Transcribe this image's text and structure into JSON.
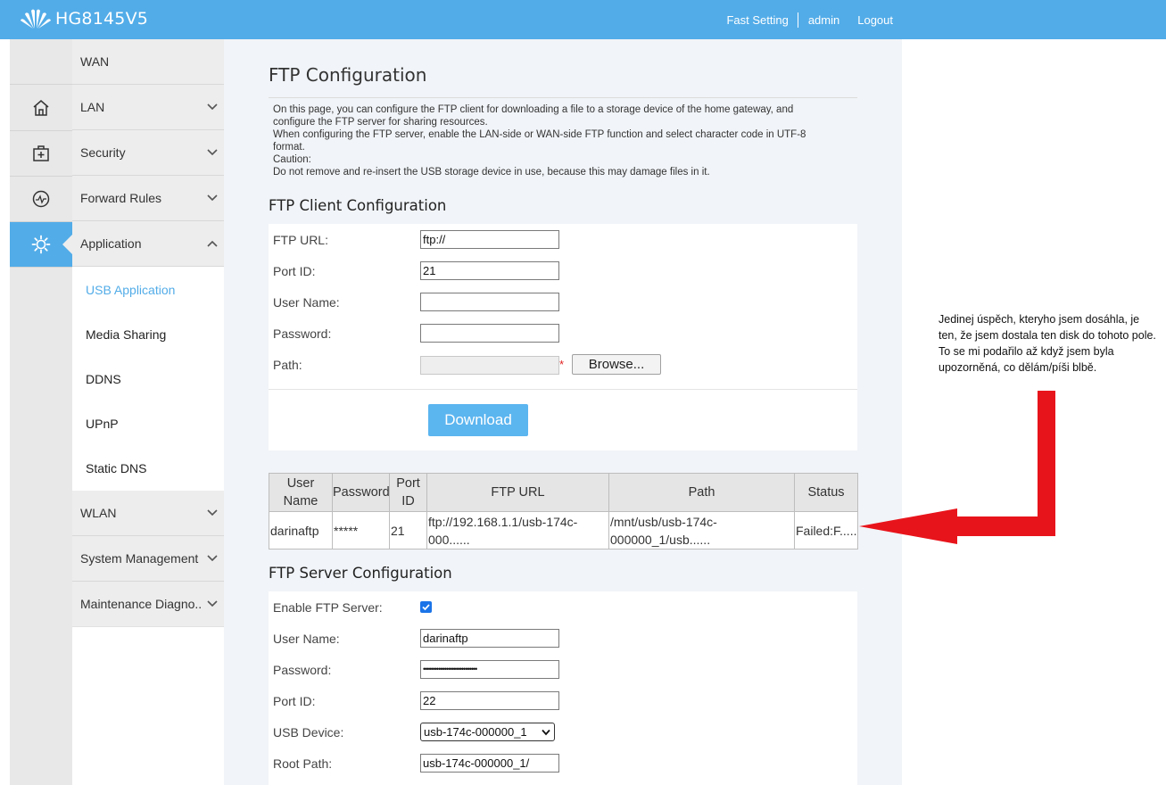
{
  "header": {
    "brand_icon": "huawei-logo",
    "model": "HG8145V5",
    "links": {
      "fast_setting": "Fast Setting",
      "admin": "admin",
      "logout": "Logout"
    },
    "bar_color": "#52ace8"
  },
  "icons": {
    "home": "home-icon",
    "plus": "add-box-icon",
    "monitor": "pulse-icon",
    "application": "gear-icon"
  },
  "menu": {
    "items": {
      "wan": "WAN",
      "lan": "LAN",
      "security": "Security",
      "forward": "Forward Rules",
      "application": "Application",
      "wlan": "WLAN",
      "system": "System Management",
      "maintenance": "Maintenance Diagno.."
    },
    "sub": {
      "usb": "USB Application",
      "media": "Media Sharing",
      "ddns": "DDNS",
      "upnp": "UPnP",
      "staticdns": "Static DNS"
    }
  },
  "page": {
    "title": "FTP Configuration",
    "description": [
      "On this page, you can configure the FTP client for downloading a file to a storage device of the home gateway, and",
      "configure the FTP server for sharing resources.",
      "When configuring the FTP server, enable the LAN-side or WAN-side FTP function and select character code in UTF-8",
      "format.",
      "Caution:",
      "Do not remove and re-insert the USB storage device in use, because this may damage files in it."
    ]
  },
  "client": {
    "title": "FTP Client Configuration",
    "labels": {
      "url": "FTP URL:",
      "port": "Port ID:",
      "user": "User Name:",
      "password": "Password:",
      "path": "Path:"
    },
    "values": {
      "url": "ftp://",
      "port": "21",
      "user": "",
      "password": "",
      "path": ""
    },
    "required_mark": "*",
    "browse": "Browse...",
    "download": "Download"
  },
  "table": {
    "headers": {
      "user": "User Name",
      "password": "Password",
      "port": "Port ID",
      "url": "FTP URL",
      "path": "Path",
      "status": "Status"
    },
    "row": {
      "user": "darinaftp",
      "password": "*****",
      "port": "21",
      "url": "ftp://192.168.1.1/usb-174c-000......",
      "path": "/mnt/usb/usb-174c-000000_1/usb......",
      "status": "Failed:F......"
    }
  },
  "server": {
    "title": "FTP Server Configuration",
    "labels": {
      "enable": "Enable FTP Server:",
      "user": "User Name:",
      "password": "Password:",
      "port": "Port ID:",
      "device": "USB Device:",
      "root": "Root Path:"
    },
    "values": {
      "enable": true,
      "user": "darinaftp",
      "password": "••••••••••••••••••••••••••••",
      "port": "22",
      "device": "usb-174c-000000_1",
      "root": "usb-174c-000000_1/"
    }
  },
  "annotation": {
    "text": "Jedinej úspěch, kteryho jsem dosáhla, je ten, že jsem dostala ten disk do tohoto pole. To se mi podařilo až když jsem byla upozorněná, co dělám/píši blbě.",
    "arrow_color": "#e8141b"
  }
}
